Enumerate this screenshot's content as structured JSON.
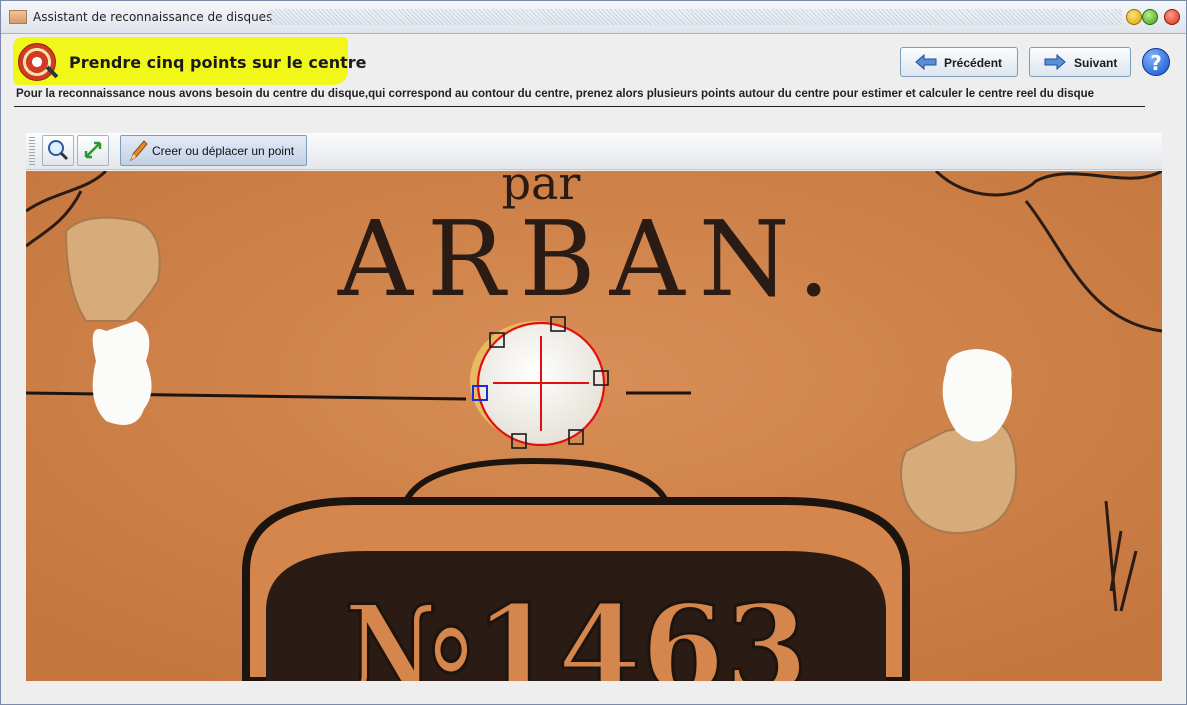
{
  "window": {
    "title": "Assistant de reconnaissance de disques"
  },
  "header": {
    "heading": "Prendre cinq points sur le centre",
    "description": "Pour la reconnaissance nous avons besoin du centre du disque,qui correspond au contour du centre, prenez alors plusieurs points autour du centre pour estimer et calculer le centre reel du disque"
  },
  "nav": {
    "previous_label": "Précédent",
    "next_label": "Suivant",
    "help_label": "?"
  },
  "toolbar": {
    "draw_point_label": "Creer ou déplacer un point"
  },
  "image": {
    "label_text": "ARBAN.",
    "par_text": "par",
    "number_text": "№1463"
  },
  "colors": {
    "label_paper": "#d0824a",
    "circle": "#e01010",
    "highlight": "#f2f71a",
    "button_border": "#7f9db9"
  },
  "icons": {
    "zoom": "magnifier-icon",
    "fit": "fit-screen-icon",
    "draw": "pencil-icon",
    "previous": "arrow-left-icon",
    "next": "arrow-right-icon"
  }
}
